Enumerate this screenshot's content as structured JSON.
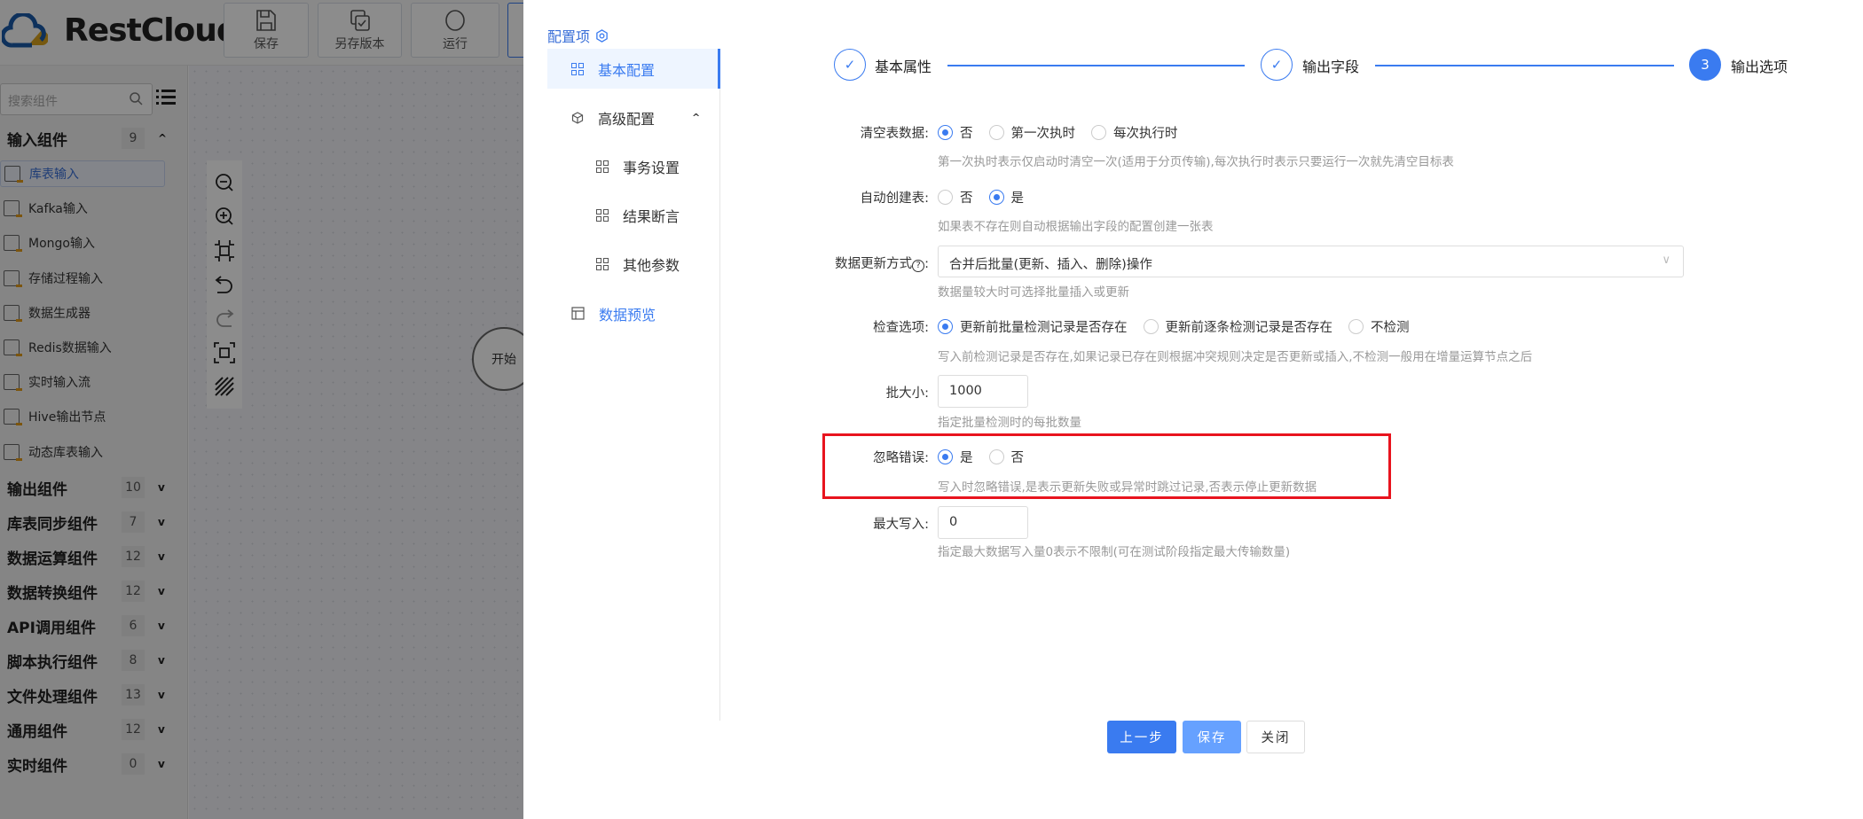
{
  "header": {
    "logo": "RestCloud",
    "toolbar": [
      {
        "label": "保存",
        "icon": "save-icon"
      },
      {
        "label": "另存版本",
        "icon": "save-version-icon"
      },
      {
        "label": "运行",
        "icon": "run-icon"
      }
    ]
  },
  "sidebar": {
    "search_placeholder": "搜索组件",
    "groups": [
      {
        "label": "输入组件",
        "count": "9",
        "expanded": true
      },
      {
        "label": "输出组件",
        "count": "10"
      },
      {
        "label": "库表同步组件",
        "count": "7"
      },
      {
        "label": "数据运算组件",
        "count": "12"
      },
      {
        "label": "数据转换组件",
        "count": "12"
      },
      {
        "label": "API调用组件",
        "count": "6"
      },
      {
        "label": "脚本执行组件",
        "count": "8"
      },
      {
        "label": "文件处理组件",
        "count": "13"
      },
      {
        "label": "通用组件",
        "count": "12"
      },
      {
        "label": "实时组件",
        "count": "0"
      }
    ],
    "items": [
      {
        "label": "库表输入",
        "active": true
      },
      {
        "label": "Kafka输入"
      },
      {
        "label": "Mongo输入"
      },
      {
        "label": "存储过程输入"
      },
      {
        "label": "数据生成器"
      },
      {
        "label": "Redis数据输入"
      },
      {
        "label": "实时输入流"
      },
      {
        "label": "Hive输出节点"
      },
      {
        "label": "动态库表输入"
      }
    ]
  },
  "canvas": {
    "start_node": "开始"
  },
  "modal": {
    "nav_title": "配置项",
    "nav": [
      {
        "label": "基本配置",
        "active": true
      },
      {
        "label": "高级配置"
      },
      {
        "label": "事务设置"
      },
      {
        "label": "结果断言"
      },
      {
        "label": "其他参数"
      },
      {
        "label": "数据预览"
      }
    ],
    "steps": [
      {
        "label": "基本属性",
        "status": "done"
      },
      {
        "label": "输出字段",
        "status": "done"
      },
      {
        "label": "输出选项",
        "number": "3",
        "status": "current"
      }
    ],
    "form": {
      "clear": {
        "label": "清空表数据:",
        "options": [
          "否",
          "第一次执时",
          "每次执行时"
        ],
        "selected": 0,
        "hint": "第一次执时表示仅启动时清空一次(适用于分页传输),每次执行时表示只要运行一次就先清空目标表"
      },
      "autocreate": {
        "label": "自动创建表:",
        "options": [
          "否",
          "是"
        ],
        "selected": 1,
        "hint": "如果表不存在则自动根据输出字段的配置创建一张表"
      },
      "update": {
        "label": "数据更新方式",
        "colon": ":",
        "value": "合并后批量(更新、插入、删除)操作",
        "hint": "数据量较大时可选择批量插入或更新"
      },
      "check": {
        "label": "检查选项:",
        "options": [
          "更新前批量检测记录是否存在",
          "更新前逐条检测记录是否存在",
          "不检测"
        ],
        "selected": 0,
        "hint": "写入前检测记录是否存在,如果记录已存在则根据冲突规则决定是否更新或插入,不检测一般用在增量运算节点之后"
      },
      "batch": {
        "label": "批大小:",
        "value": "1000",
        "hint": "指定批量检测时的每批数量"
      },
      "ignore": {
        "label": "忽略错误:",
        "options": [
          "是",
          "否"
        ],
        "selected": 0,
        "hint": "写入时忽略错误,是表示更新失败或异常时跳过记录,否表示停止更新数据"
      },
      "max": {
        "label": "最大写入:",
        "value": "0",
        "hint": "指定最大数据写入量0表示不限制(可在测试阶段指定最大传输数量)"
      }
    },
    "buttons": {
      "prev": "上一步",
      "save": "保存",
      "close": "关闭"
    },
    "colors": {
      "primary": "#3a7bf0",
      "save_light": "#66a1ff",
      "highlight": "#e8141e"
    }
  }
}
